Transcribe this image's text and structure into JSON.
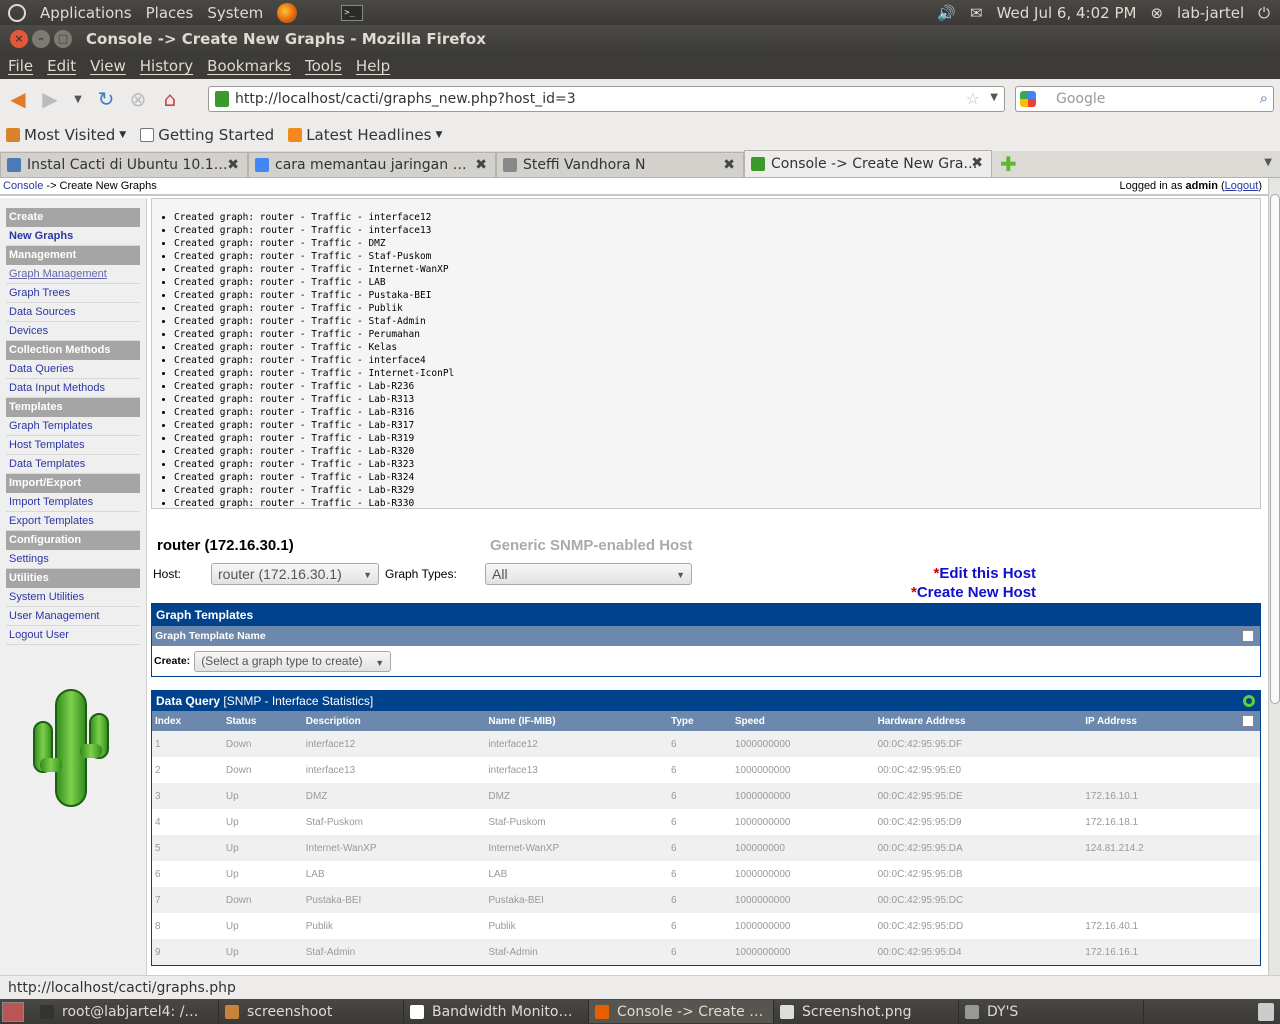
{
  "system_bar": {
    "applications": "Applications",
    "places": "Places",
    "system": "System",
    "datetime": "Wed Jul  6,  4:02 PM",
    "user": "lab-jartel"
  },
  "window": {
    "title": "Console -> Create New Graphs - Mozilla Firefox"
  },
  "menubar": [
    "File",
    "Edit",
    "View",
    "History",
    "Bookmarks",
    "Tools",
    "Help"
  ],
  "nav": {
    "url": "http://localhost/cacti/graphs_new.php?host_id=3",
    "search_placeholder": "Google"
  },
  "bookmarks": [
    "Most Visited",
    "Getting Started",
    "Latest Headlines"
  ],
  "tabs": [
    {
      "label": "Instal Cacti di Ubuntu 10.1…",
      "icon_color": "#4a7bb7"
    },
    {
      "label": "cara memantau jaringan …",
      "icon_color": "#4285f4"
    },
    {
      "label": "Steffi Vandhora N",
      "icon_color": "#888888"
    },
    {
      "label": "Console -> Create New Gra…",
      "icon_color": "#3c9a2d"
    }
  ],
  "page": {
    "crumb_link": "Console",
    "crumb_rest": " -> Create New Graphs",
    "logged_prefix": "Logged in as ",
    "logged_user": "admin",
    "logout": "Logout"
  },
  "sidebar": [
    {
      "type": "head",
      "label": "Create"
    },
    {
      "type": "item",
      "label": "New Graphs",
      "active": true
    },
    {
      "type": "head",
      "label": "Management"
    },
    {
      "type": "item",
      "label": "Graph Management",
      "hover": true
    },
    {
      "type": "item",
      "label": "Graph Trees"
    },
    {
      "type": "item",
      "label": "Data Sources"
    },
    {
      "type": "item",
      "label": "Devices"
    },
    {
      "type": "head",
      "label": "Collection Methods"
    },
    {
      "type": "item",
      "label": "Data Queries"
    },
    {
      "type": "item",
      "label": "Data Input Methods"
    },
    {
      "type": "head",
      "label": "Templates"
    },
    {
      "type": "item",
      "label": "Graph Templates"
    },
    {
      "type": "item",
      "label": "Host Templates"
    },
    {
      "type": "item",
      "label": "Data Templates"
    },
    {
      "type": "head",
      "label": "Import/Export"
    },
    {
      "type": "item",
      "label": "Import Templates"
    },
    {
      "type": "item",
      "label": "Export Templates"
    },
    {
      "type": "head",
      "label": "Configuration"
    },
    {
      "type": "item",
      "label": "Settings"
    },
    {
      "type": "head",
      "label": "Utilities"
    },
    {
      "type": "item",
      "label": "System Utilities"
    },
    {
      "type": "item",
      "label": "User Management"
    },
    {
      "type": "item",
      "label": "Logout User"
    }
  ],
  "messages": [
    "Created graph: router - Traffic - interface12",
    "Created graph: router - Traffic - interface13",
    "Created graph: router - Traffic - DMZ",
    "Created graph: router - Traffic - Staf-Puskom",
    "Created graph: router - Traffic - Internet-WanXP",
    "Created graph: router - Traffic - LAB",
    "Created graph: router - Traffic - Pustaka-BEI",
    "Created graph: router - Traffic - Publik",
    "Created graph: router - Traffic - Staf-Admin",
    "Created graph: router - Traffic - Perumahan",
    "Created graph: router - Traffic - Kelas",
    "Created graph: router - Traffic - interface4",
    "Created graph: router - Traffic - Internet-IconPl",
    "Created graph: router - Traffic - Lab-R236",
    "Created graph: router - Traffic - Lab-R313",
    "Created graph: router - Traffic - Lab-R316",
    "Created graph: router - Traffic - Lab-R317",
    "Created graph: router - Traffic - Lab-R319",
    "Created graph: router - Traffic - Lab-R320",
    "Created graph: router - Traffic - Lab-R323",
    "Created graph: router - Traffic - Lab-R324",
    "Created graph: router - Traffic - Lab-R329",
    "Created graph: router - Traffic - Lab-R330"
  ],
  "host": {
    "title": "router (172.16.30.1)",
    "template": "Generic SNMP-enabled Host",
    "host_label": "Host:",
    "host_value": "router (172.16.30.1)",
    "types_label": "Graph Types:",
    "types_value": "All",
    "edit_link": "Edit this Host",
    "create_link": "Create New Host"
  },
  "graph_templates": {
    "title": "Graph Templates",
    "column": "Graph Template Name",
    "create_label": "Create:",
    "create_value": "(Select a graph type to create)"
  },
  "data_query": {
    "title_bold": "Data Query",
    "title_rest": " [SNMP - Interface Statistics]",
    "columns": [
      "Index",
      "Status",
      "Description",
      "Name (IF-MIB)",
      "Type",
      "Speed",
      "Hardware Address",
      "IP Address"
    ],
    "rows": [
      [
        "1",
        "Down",
        "interface12",
        "interface12",
        "6",
        "1000000000",
        "00:0C:42:95:95:DF",
        ""
      ],
      [
        "2",
        "Down",
        "interface13",
        "interface13",
        "6",
        "1000000000",
        "00:0C:42:95:95:E0",
        ""
      ],
      [
        "3",
        "Up",
        "DMZ",
        "DMZ",
        "6",
        "1000000000",
        "00:0C:42:95:95:DE",
        "172.16.10.1"
      ],
      [
        "4",
        "Up",
        "Staf-Puskom",
        "Staf-Puskom",
        "6",
        "1000000000",
        "00:0C:42:95:95:D9",
        "172.16.18.1"
      ],
      [
        "5",
        "Up",
        "Internet-WanXP",
        "Internet-WanXP",
        "6",
        "100000000",
        "00:0C:42:95:95:DA",
        "124.81.214.2"
      ],
      [
        "6",
        "Up",
        "LAB",
        "LAB",
        "6",
        "1000000000",
        "00:0C:42:95:95:DB",
        ""
      ],
      [
        "7",
        "Down",
        "Pustaka-BEI",
        "Pustaka-BEI",
        "6",
        "1000000000",
        "00:0C:42:95:95:DC",
        ""
      ],
      [
        "8",
        "Up",
        "Publik",
        "Publik",
        "6",
        "1000000000",
        "00:0C:42:95:95:DD",
        "172.16.40.1"
      ],
      [
        "9",
        "Up",
        "Staf-Admin",
        "Staf-Admin",
        "6",
        "1000000000",
        "00:0C:42:95:95:D4",
        "172.16.16.1"
      ]
    ]
  },
  "status": {
    "text": "http://localhost/cacti/graphs.php"
  },
  "taskbar": [
    {
      "label": "root@labjartel4: /…",
      "icon_color": "#333333"
    },
    {
      "label": "screenshoot",
      "icon_color": "#c8833a"
    },
    {
      "label": "Bandwidth Monito…",
      "icon_color": "#ffffff"
    },
    {
      "label": "Console -> Create …",
      "icon_color": "#e66000",
      "active": true
    },
    {
      "label": "Screenshot.png",
      "icon_color": "#dddddd"
    },
    {
      "label": "DY'S",
      "icon_color": "#999999"
    }
  ]
}
